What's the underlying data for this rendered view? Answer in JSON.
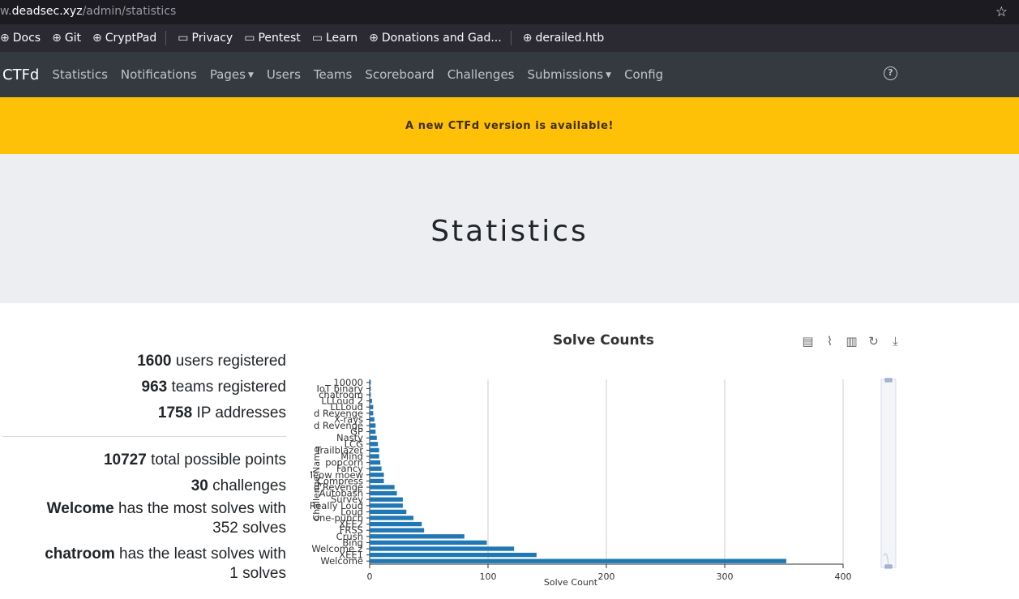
{
  "browser": {
    "url_prefix": "w.",
    "url_host": "deadsec.xyz",
    "url_path": "/admin/statistics",
    "bookmarks": [
      {
        "label": "Docs",
        "icon": "globe-icon"
      },
      {
        "label": "Git",
        "icon": "globe-icon"
      },
      {
        "label": "CryptPad",
        "icon": "globe-icon"
      },
      {
        "label": "Privacy",
        "icon": "folder-icon"
      },
      {
        "label": "Pentest",
        "icon": "folder-icon"
      },
      {
        "label": "Learn",
        "icon": "folder-icon"
      },
      {
        "label": "Donations and Gad...",
        "icon": "globe-icon"
      },
      {
        "label": "derailed.htb",
        "icon": "globe-icon"
      }
    ]
  },
  "nav": {
    "brand": "CTFd",
    "items": [
      "Statistics",
      "Notifications",
      "Pages",
      "Users",
      "Teams",
      "Scoreboard",
      "Challenges",
      "Submissions",
      "Config"
    ],
    "help": "?"
  },
  "alert": "A new CTFd version is available!",
  "page_title": "Statistics",
  "stats": {
    "users_count": "1600",
    "users_text": "users registered",
    "teams_count": "963",
    "teams_text": "teams registered",
    "ip_count": "1758",
    "ip_text": "IP addresses",
    "points_count": "10727",
    "points_text": "total possible points",
    "challenges_count": "30",
    "challenges_text": "challenges",
    "most_name": "Welcome",
    "most_text": "has the most solves with",
    "most_solves": "352 solves",
    "least_name": "chatroom",
    "least_text": "has the least solves with",
    "least_solves": "1 solves"
  },
  "colors": {
    "bar": "#1f77b4",
    "navbar": "#343a40",
    "alert": "#ffc107"
  },
  "chart_data": {
    "type": "bar",
    "orientation": "horizontal",
    "title": "Solve Counts",
    "xlabel": "Solve Count",
    "ylabel": "Challenge Name",
    "xlim": [
      0,
      400
    ],
    "x_ticks": [
      "0",
      "100",
      "200",
      "300",
      "400"
    ],
    "grid": true,
    "toolbox": [
      "data-view-icon",
      "line-chart-icon",
      "bar-chart-icon",
      "restore-icon",
      "download-icon"
    ],
    "categories": [
      "Welcome",
      "XEE1",
      "Welcome 2",
      "Bing",
      "Crush",
      "FRSS",
      "XEE2",
      "one-punch",
      "Loud",
      "Really Loud",
      "Survey",
      "Autobash",
      "d Revenge",
      "Compress",
      "Meow moew",
      "Fancy",
      "popcorn",
      "Mind",
      "Trailblazer",
      "LCG",
      "Nasty",
      "GP",
      "d Revenge",
      "X-rays",
      "d Revenge",
      "LLLoud",
      "LLLoud 2",
      "chatroom",
      "IoT binary",
      "10000"
    ],
    "values": [
      352,
      141,
      122,
      99,
      80,
      46,
      44,
      37,
      31,
      28,
      28,
      23,
      21,
      12,
      12,
      10,
      9,
      8,
      8,
      7,
      6,
      5,
      5,
      4,
      3,
      3,
      2,
      1,
      1,
      1
    ]
  }
}
